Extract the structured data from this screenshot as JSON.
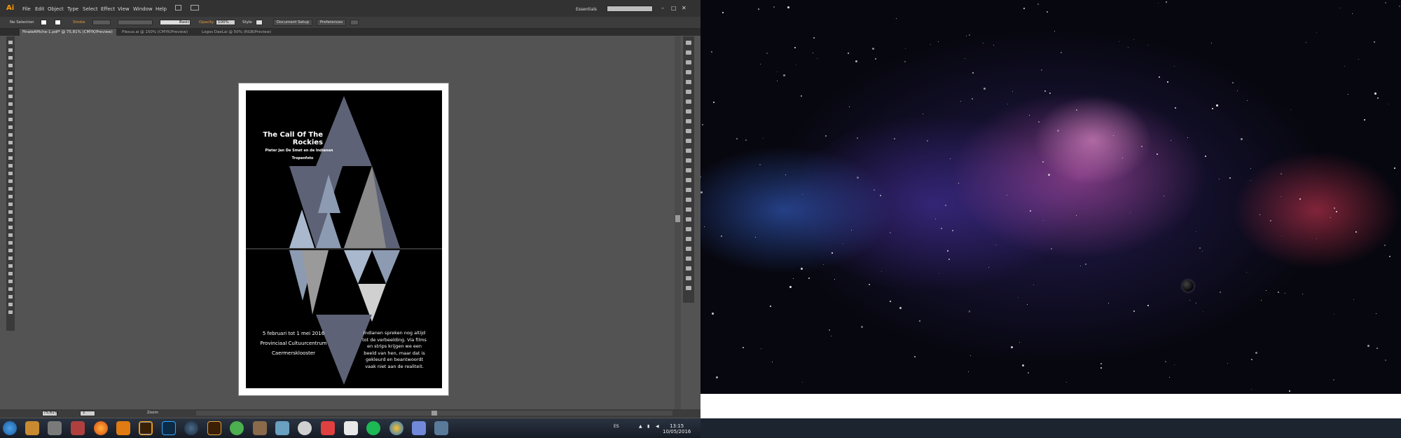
{
  "app": {
    "logo": "Ai",
    "menus": [
      "File",
      "Edit",
      "Object",
      "Type",
      "Select",
      "Effect",
      "View",
      "Window",
      "Help"
    ],
    "workspace": "Essentials",
    "search_placeholder": "",
    "window_buttons": [
      "–",
      "□",
      "✕"
    ]
  },
  "control_bar": {
    "selection": "No Selection",
    "stroke_label": "Stroke",
    "brush_label": "Basic",
    "opacity_label": "Opacity",
    "opacity_value": "100%",
    "style_label": "Style",
    "document_setup": "Document Setup",
    "preferences": "Preferences"
  },
  "tabs": [
    {
      "label": "FinaleAffiche-1.pdf* @ 75,81% (CMYK/Preview)",
      "active": true
    },
    {
      "label": "Plexus.ai @ 150% (CMYK/Preview)",
      "active": false
    },
    {
      "label": "Logos DaeLai @ 50% (RGB/Preview)",
      "active": false
    }
  ],
  "status_bar": {
    "zoom": "75,81%",
    "page": "1",
    "tool": "Zoom"
  },
  "poster": {
    "title_line1": "The Call Of The",
    "title_line2": "Rockies",
    "subtitle1": "Pieter Jan De Smet en de Indianen",
    "subtitle2": "Tropenfoto",
    "dates_line1": "5 februari tot 1 mei 2016",
    "dates_line2": "Provinciaal Cultuurcentrum",
    "dates_line3": "Caermersklooster",
    "quote_line1": "Indianen spreken nog altijd",
    "quote_line2": "tot de verbeelding. Via films",
    "quote_line3": "en strips krijgen we een",
    "quote_line4": "beeld van hen, maar dat is",
    "quote_line5": "gekleurd en beantwoordt",
    "quote_line6": "vaak niet aan de realiteit."
  },
  "taskbar": {
    "language": "ES",
    "time": "13:15",
    "date": "10/05/2016"
  },
  "colors": {
    "triangle_dark": "#5e6276",
    "triangle_light": "#a9b8cd",
    "triangle_mid": "#8c9bb2",
    "illustrator_bg": "#535353"
  }
}
